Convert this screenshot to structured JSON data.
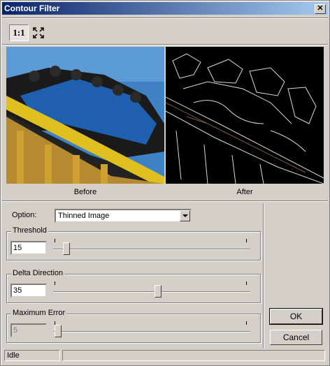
{
  "window": {
    "title": "Contour Filter",
    "close_glyph": "✕"
  },
  "toolbar": {
    "actual_size_label": "1:1",
    "fit_icon": "fit-to-window-icon"
  },
  "previews": {
    "before_label": "Before",
    "after_label": "After"
  },
  "option": {
    "label": "Option:",
    "selected": "Thinned Image"
  },
  "threshold": {
    "label": "Threshold",
    "value": "15",
    "slider_fraction": 0.07
  },
  "delta_direction": {
    "label": "Delta Direction",
    "value": "35",
    "slider_fraction": 0.55
  },
  "maximum_error": {
    "label": "Maximum Error",
    "value": "5",
    "slider_fraction": 0.02,
    "disabled": true
  },
  "buttons": {
    "ok": "OK",
    "cancel": "Cancel"
  },
  "status": {
    "text": "Idle"
  },
  "colors": {
    "title_start": "#0a246a",
    "title_end": "#a6caf0",
    "face": "#d4d0c8",
    "sky": "#3f82c4",
    "track_yellow": "#e0c020"
  }
}
